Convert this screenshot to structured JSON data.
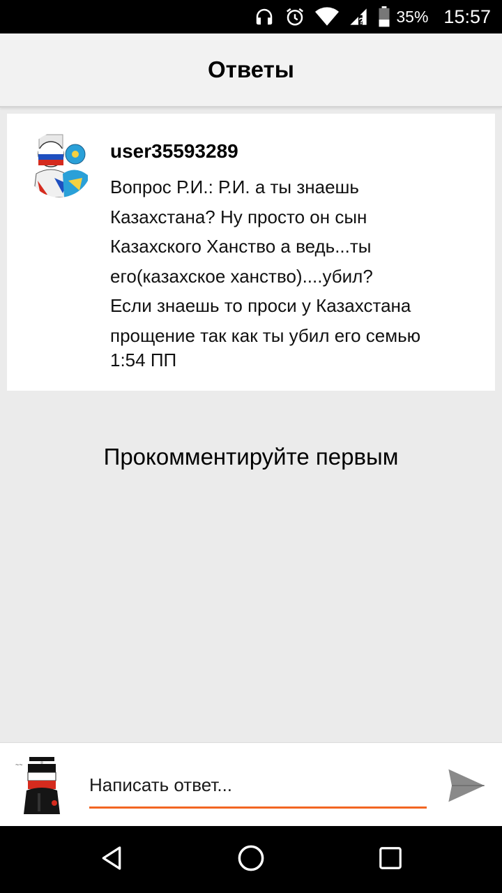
{
  "status_bar": {
    "battery_percent": "35%",
    "time": "15:57"
  },
  "header": {
    "title": "Ответы"
  },
  "post": {
    "username": "user35593289",
    "message": "Вопрос Р.И.: Р.И. а ты знаешь\nКазахстана? Ну просто он сын\nКазахского Ханство а ведь...ты\nего(казахское ханство)....убил?\nЕсли знаешь то проси у Казахстана\nпрощение так как ты убил его семью",
    "timestamp": "1:54 ПП"
  },
  "empty_state": {
    "text": "Прокомментируйте первым"
  },
  "composer": {
    "placeholder": "Написать ответ...",
    "accent_color": "#f26522"
  },
  "icons": {
    "headphones": "headphones-icon",
    "alarm": "alarm-icon",
    "wifi": "wifi-icon",
    "signal": "signal-icon",
    "battery": "battery-icon",
    "send": "send-icon",
    "back": "back-icon",
    "home": "home-icon",
    "recents": "recents-icon"
  }
}
